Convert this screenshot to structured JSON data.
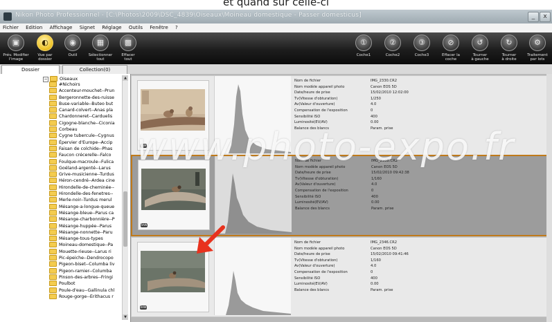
{
  "caption": "et quand sur celle-ci",
  "window": {
    "title": "Nikon Photo Professionnel - [C:\\Photos\\2009\\DSC_4839\\Oiseaux\\Moineau domestique - Passer domesticus]",
    "minimize": "_",
    "close": "x"
  },
  "menu": [
    "Fichier",
    "Edition",
    "Affichage",
    "Signet",
    "Réglage",
    "Outils",
    "Fenêtre",
    "?"
  ],
  "toolbar_left": [
    {
      "label": "Prév. Modifier\nl'image",
      "icon": "screen-icon"
    },
    {
      "label": "Vue par\ndossier",
      "icon": "folder-view-icon",
      "active": true
    },
    {
      "label": "Outil",
      "icon": "tool-icon"
    },
    {
      "label": "Sélectionner\ntout",
      "icon": "select-all-icon"
    },
    {
      "label": "Effacer\ntout",
      "icon": "clear-all-icon"
    }
  ],
  "toolbar_right": [
    {
      "label": "Coche1",
      "icon": "mark1-icon"
    },
    {
      "label": "Coche2",
      "icon": "mark2-icon"
    },
    {
      "label": "Coche3",
      "icon": "mark3-icon"
    },
    {
      "label": "Effacer la\ncoche",
      "icon": "clear-mark-icon"
    },
    {
      "label": "Tourner\nà gauche",
      "icon": "rotate-left-icon"
    },
    {
      "label": "Tourner\nà droite",
      "icon": "rotate-right-icon"
    },
    {
      "label": "Traitement\npar lots",
      "icon": "batch-icon"
    }
  ],
  "tabs": [
    {
      "label": "Dossier",
      "active": true
    },
    {
      "label": "Collection(0)",
      "active": false
    }
  ],
  "tree": {
    "root": "Oiseaux",
    "items": [
      "#Nichoirs",
      "Accenteur-mouchet--Prun",
      "Bergeronnette-des-ruisse",
      "Buse-variable--Buteo but",
      "Canard-colvert--Anas pla",
      "Chardonneret--Carduelis",
      "Cigogne-blanche--Ciconia",
      "Corbeau",
      "Cygne tubercule--Cygnus",
      "Épervier d'Europe--Accip",
      "Faisan de colchide--Phas",
      "Faucon crécerelle--Falco",
      "Foulque-macroule--Fulica",
      "Goéland-argenté--Larus",
      "Grive-musicienne--Turdus",
      "Héron-cendré--Ardea cine",
      "Hirondelle-de-cheminée--",
      "Hirondelle-des-fenetres--",
      "Merle-noir--Turdus merul",
      "Mésange-a-longue-queue",
      "Mésange-bleue--Parus ca",
      "Mésange-charbonnière--P",
      "Mésange-huppée--Parus",
      "Mésange-nonnette--Paru",
      "Mésange-tous-types",
      "Moineau-domestique--Pa",
      "Mouette-rieuse--Larus ri",
      "Pic-épeiche--Dendrocopo",
      "Pigeon-biset--Columba liv",
      "Pigeon-ramier--Columba",
      "Pinson-des-arbres--Fringi",
      "Poulbot",
      "Poule-d'eau--Gallinula chl",
      "Rouge-gorge--Erithacus r"
    ]
  },
  "meta_keys": [
    "Nom de fichier",
    "Nom modèle appareil photo",
    "Date/heure de prise",
    "Tv(Vitesse d'obturation)",
    "Av(Valeur d'ouverture)",
    "Compensation de l'exposition",
    "Sensibilité ISO",
    "Luminosité(EV/AV)",
    "Balance des blancs"
  ],
  "cards": [
    {
      "selected": false,
      "values": [
        "IMG_2330.CR2",
        "Canon EOS 5D",
        "15/02/2010 12:02:00",
        "1/250",
        "4.0",
        "0",
        "400",
        "0.00",
        "Param. prise"
      ]
    },
    {
      "selected": true,
      "values": [
        "IMG_2338.CR2",
        "Canon EOS 5D",
        "15/02/2010 09:42:38",
        "1/160",
        "4.0",
        "0",
        "400",
        "0.00",
        "Param. prise"
      ]
    },
    {
      "selected": false,
      "values": [
        "IMG_2346.CR2",
        "Canon EOS 5D",
        "15/02/2010 09:41:46",
        "1/160",
        "4.0",
        "0",
        "400",
        "0.00",
        "Param. prise"
      ]
    }
  ],
  "badge": "RAW",
  "watermark": "www.photo-expo.fr",
  "colors": {
    "selection_border": "#c07a1a",
    "arrow": "#e8321e",
    "folder": "#f4cc4f"
  }
}
